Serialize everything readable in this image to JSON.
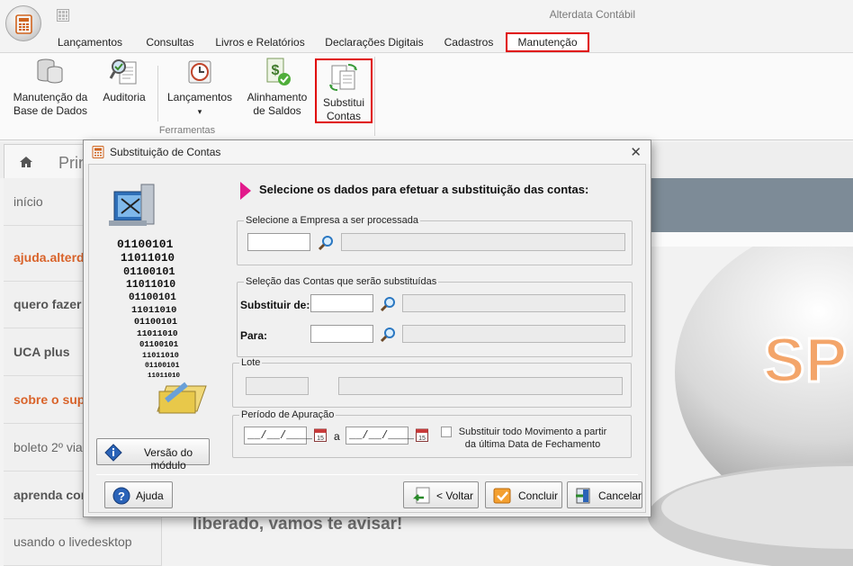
{
  "app": {
    "title": "Alterdata Contábil"
  },
  "menu": {
    "items": [
      {
        "label": "Lançamentos"
      },
      {
        "label": "Consultas"
      },
      {
        "label": "Livros e Relatórios"
      },
      {
        "label": "Declarações Digitais"
      },
      {
        "label": "Cadastros"
      },
      {
        "label": "Manutenção"
      }
    ],
    "active": "Manutenção"
  },
  "ribbon": {
    "buttons": [
      {
        "line1": "Manutenção da",
        "line2": "Base de Dados",
        "icon": "database-icon"
      },
      {
        "line1": "Auditoria",
        "line2": "",
        "icon": "audit-icon"
      },
      {
        "line1": "Lançamentos",
        "line2": "▾",
        "icon": "clock-icon"
      },
      {
        "line1": "Alinhamento",
        "line2": "de Saldos",
        "icon": "money-check-icon"
      },
      {
        "line1": "Substitui",
        "line2": "Contas",
        "icon": "swap-documents-icon"
      }
    ],
    "group_label": "Ferramentas"
  },
  "background_page": {
    "tab_label": "Prin",
    "sidebar": [
      {
        "label": "início"
      },
      {
        "label": "ajuda.alterd"
      },
      {
        "label": "quero fazer"
      },
      {
        "label": "UCA plus"
      },
      {
        "label": "sobre o sup"
      },
      {
        "label": "boleto 2º via"
      },
      {
        "label": "aprenda com"
      },
      {
        "label": "usando o livedesktop"
      }
    ],
    "banner_text": "liberado, vamos te avisar!",
    "art_text": "SP"
  },
  "dialog": {
    "title": "Substituição de Contas",
    "close_glyph": "✕",
    "headline": "Selecione os dados para efetuar a substituição das contas:",
    "art_binary": [
      "01100101",
      "11011010",
      "01100101",
      "11011010",
      "01100101",
      "11011010",
      "01100101",
      "11011010",
      "01100101",
      "11011010",
      "01100101",
      "11011010"
    ],
    "empresa": {
      "legend": "Selecione a Empresa a ser processada",
      "code": "",
      "name": ""
    },
    "contas": {
      "legend": "Seleção das Contas que serão substituídas",
      "from_label": "Substituir de:",
      "from_code": "",
      "from_name": "",
      "to_label": "Para:",
      "to_code": "",
      "to_name": ""
    },
    "lote": {
      "legend": "Lote",
      "code": "",
      "name": ""
    },
    "periodo": {
      "legend": "Período de Apuração",
      "start": "__/__/____",
      "separator": "a",
      "end": "__/__/____",
      "checkbox_line1": "Substituir todo Movimento a partir",
      "checkbox_line2": "da última Data de Fechamento",
      "checked": false
    },
    "buttons": {
      "version": "Versão do módulo",
      "help": "Ajuda",
      "back": "< Voltar",
      "finish": "Concluir",
      "cancel": "Cancelar"
    }
  }
}
